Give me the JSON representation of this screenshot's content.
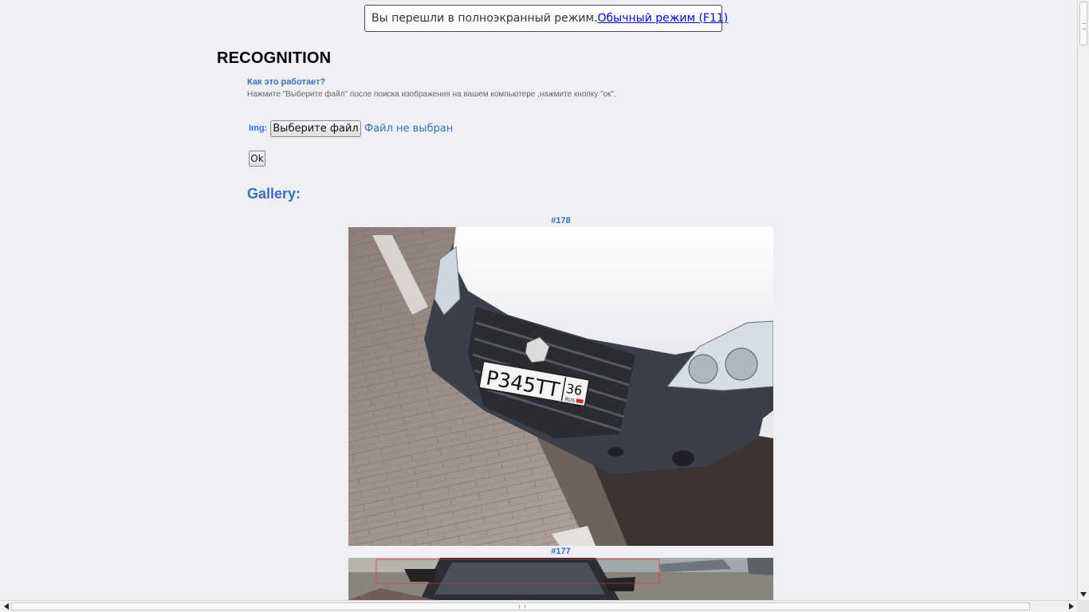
{
  "fullscreen_notice": {
    "message": "Вы перешли в полноэкранный режим.",
    "exit_link": "Обычный режим (F11)"
  },
  "page": {
    "title": "RECOGNITION",
    "how_it_works_title": "Как это работает?",
    "how_it_works_text": "Нажмите \"Выберите файл\" после поиска изображения на вашем компьютере ,нажмите кнопку \"ок\"."
  },
  "upload_form": {
    "img_label": "Img:",
    "choose_file_label": "Выберите файл",
    "no_file_text": "Файл не выбран",
    "ok_label": "Ok"
  },
  "gallery": {
    "title": "Gallery:",
    "items": [
      {
        "caption": "#178",
        "plate_text": "P345TT",
        "plate_region": "36",
        "plate_country": "RUS"
      },
      {
        "caption": "#177"
      }
    ]
  },
  "colors": {
    "accent": "#3a6cc8",
    "background": "#eef0f4",
    "link": "#0000ee"
  },
  "icons": {
    "scroll_up": "chevron-up-icon",
    "scroll_down": "triangle-down-icon",
    "scroll_left": "triangle-left-icon",
    "scroll_right": "triangle-right-icon"
  }
}
